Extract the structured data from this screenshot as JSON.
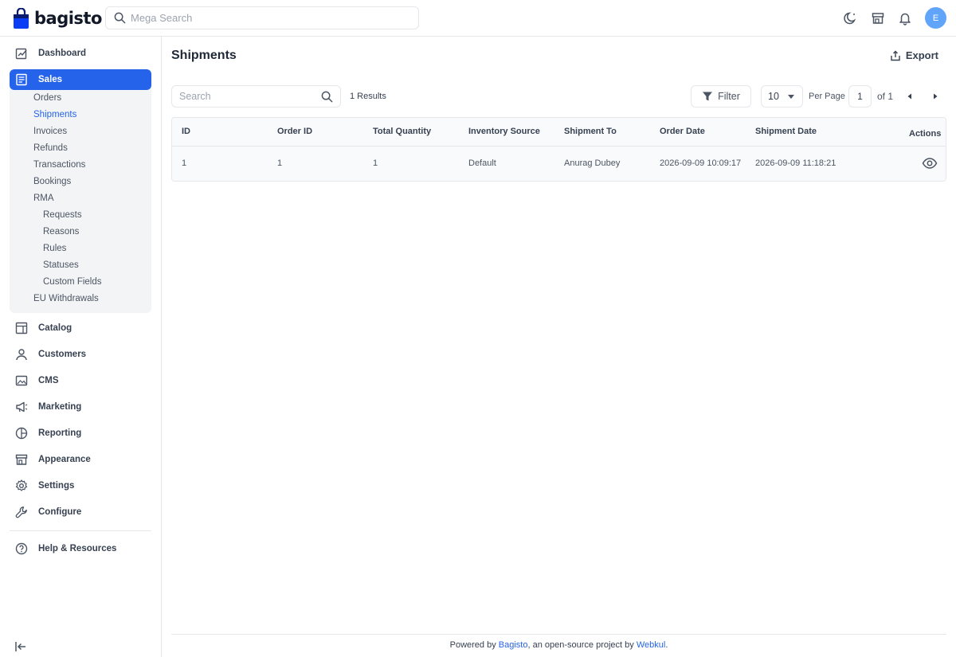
{
  "header": {
    "logo_text": "bagisto",
    "search_placeholder": "Mega Search",
    "avatar_initial": "E"
  },
  "sidebar": {
    "items": [
      {
        "label": "Dashboard"
      },
      {
        "label": "Sales"
      },
      {
        "label": "Catalog"
      },
      {
        "label": "Customers"
      },
      {
        "label": "CMS"
      },
      {
        "label": "Marketing"
      },
      {
        "label": "Reporting"
      },
      {
        "label": "Appearance"
      },
      {
        "label": "Settings"
      },
      {
        "label": "Configure"
      },
      {
        "label": "Help & Resources"
      }
    ],
    "sales_sub": [
      "Orders",
      "Shipments",
      "Invoices",
      "Refunds",
      "Transactions",
      "Bookings",
      "RMA"
    ],
    "rma_sub": [
      "Requests",
      "Reasons",
      "Rules",
      "Statuses",
      "Custom Fields"
    ],
    "eu_withdrawals": "EU Withdrawals"
  },
  "main": {
    "title": "Shipments",
    "export_label": "Export",
    "search_placeholder": "Search",
    "results": "1 Results",
    "filter_label": "Filter",
    "per_page_value": "10",
    "per_page_label": "Per Page",
    "page_value": "1",
    "page_of": "of 1"
  },
  "table": {
    "columns": [
      "ID",
      "Order ID",
      "Total Quantity",
      "Inventory Source",
      "Shipment To",
      "Order Date",
      "Shipment Date",
      "Actions"
    ],
    "rows": [
      [
        "1",
        "1",
        "1",
        "Default",
        "Anurag Dubey",
        "2026-09-09 10:09:17",
        "2026-09-09 11:18:21"
      ]
    ]
  },
  "footer": {
    "prefix": "Powered by ",
    "link1": "Bagisto",
    "middle": ", an open-source project by ",
    "link2": "Webkul",
    "suffix": "."
  },
  "colors": {
    "accent": "#2563eb",
    "avatar": "#60a5fa",
    "border": "#e5e7eb"
  }
}
